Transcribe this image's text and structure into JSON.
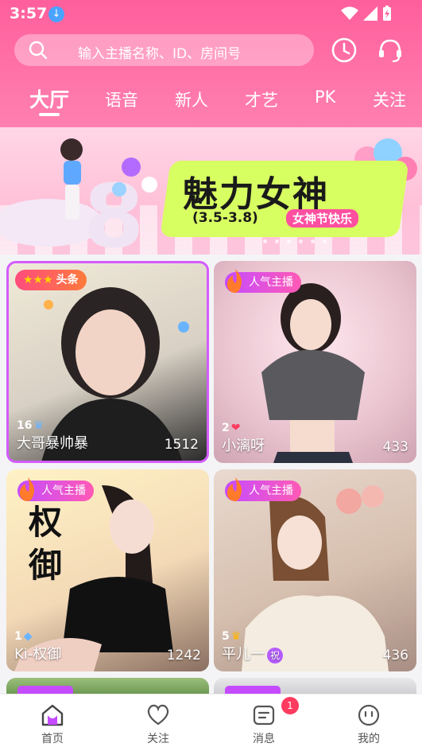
{
  "status": {
    "time": "3:57"
  },
  "search": {
    "placeholder": "输入主播名称、ID、房间号"
  },
  "tabs": [
    "大厅",
    "语音",
    "新人",
    "才艺",
    "PK",
    "关注"
  ],
  "banner": {
    "title": "魅力女神",
    "date": "(3.5-3.8)",
    "tag": "女神节快乐"
  },
  "cards": [
    {
      "badge": "头条",
      "stars": "★★★",
      "level": "16",
      "name": "大哥暴帅暴",
      "count": "1512"
    },
    {
      "badge": "人气主播",
      "level": "2",
      "name": "小漓呀",
      "count": "433"
    },
    {
      "badge": "人气主播",
      "level": "1",
      "name": "Ki-权御",
      "count": "1242",
      "overlay_text": "权御"
    },
    {
      "badge": "人气主播",
      "level": "5",
      "name": "平儿一",
      "name_tag": "祝",
      "count": "436"
    }
  ],
  "nav": {
    "items": [
      "首页",
      "关注",
      "消息",
      "我的"
    ],
    "unread": "1"
  },
  "colors": {
    "accent": "#ff5f9c",
    "badge": "#c54bff"
  }
}
